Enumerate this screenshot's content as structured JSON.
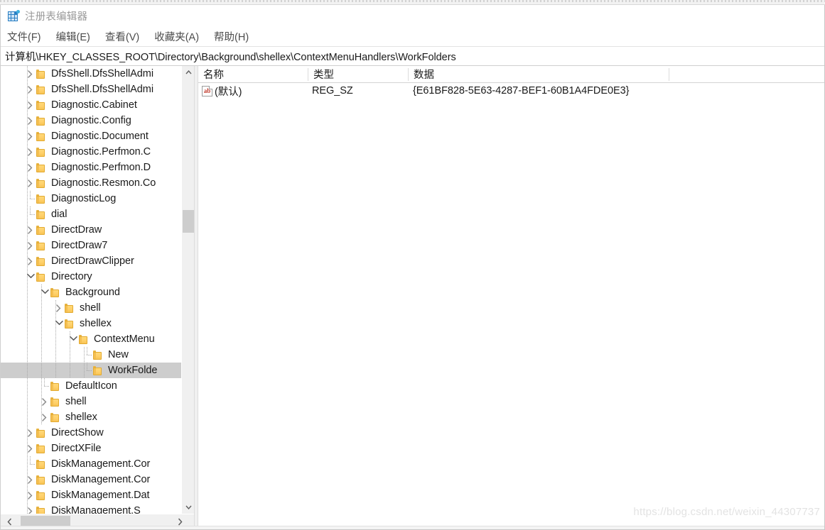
{
  "window": {
    "title": "注册表编辑器",
    "icon": "registry-editor-icon"
  },
  "menubar": {
    "items": [
      {
        "label": "文件(F)",
        "name": "menu-file"
      },
      {
        "label": "编辑(E)",
        "name": "menu-edit"
      },
      {
        "label": "查看(V)",
        "name": "menu-view"
      },
      {
        "label": "收藏夹(A)",
        "name": "menu-favorites"
      },
      {
        "label": "帮助(H)",
        "name": "menu-help"
      }
    ]
  },
  "address": {
    "path": "计算机\\HKEY_CLASSES_ROOT\\Directory\\Background\\shellex\\ContextMenuHandlers\\WorkFolders"
  },
  "tree": {
    "rows": [
      {
        "label": "DfsShell.DfsShellAdmi",
        "indent": 0,
        "expandable": true,
        "expanded": false,
        "selected": false
      },
      {
        "label": "DfsShell.DfsShellAdmi",
        "indent": 0,
        "expandable": true,
        "expanded": false,
        "selected": false
      },
      {
        "label": "Diagnostic.Cabinet",
        "indent": 0,
        "expandable": true,
        "expanded": false,
        "selected": false
      },
      {
        "label": "Diagnostic.Config",
        "indent": 0,
        "expandable": true,
        "expanded": false,
        "selected": false
      },
      {
        "label": "Diagnostic.Document",
        "indent": 0,
        "expandable": true,
        "expanded": false,
        "selected": false
      },
      {
        "label": "Diagnostic.Perfmon.C",
        "indent": 0,
        "expandable": true,
        "expanded": false,
        "selected": false
      },
      {
        "label": "Diagnostic.Perfmon.D",
        "indent": 0,
        "expandable": true,
        "expanded": false,
        "selected": false
      },
      {
        "label": "Diagnostic.Resmon.Co",
        "indent": 0,
        "expandable": true,
        "expanded": false,
        "selected": false
      },
      {
        "label": "DiagnosticLog",
        "indent": 0,
        "expandable": false,
        "expanded": false,
        "selected": false
      },
      {
        "label": "dial",
        "indent": 0,
        "expandable": false,
        "expanded": false,
        "selected": false
      },
      {
        "label": "DirectDraw",
        "indent": 0,
        "expandable": true,
        "expanded": false,
        "selected": false
      },
      {
        "label": "DirectDraw7",
        "indent": 0,
        "expandable": true,
        "expanded": false,
        "selected": false
      },
      {
        "label": "DirectDrawClipper",
        "indent": 0,
        "expandable": true,
        "expanded": false,
        "selected": false
      },
      {
        "label": "Directory",
        "indent": 0,
        "expandable": true,
        "expanded": true,
        "selected": false
      },
      {
        "label": "Background",
        "indent": 1,
        "expandable": true,
        "expanded": true,
        "selected": false
      },
      {
        "label": "shell",
        "indent": 2,
        "expandable": true,
        "expanded": false,
        "selected": false
      },
      {
        "label": "shellex",
        "indent": 2,
        "expandable": true,
        "expanded": true,
        "selected": false
      },
      {
        "label": "ContextMenu",
        "indent": 3,
        "expandable": true,
        "expanded": true,
        "selected": false
      },
      {
        "label": "New",
        "indent": 4,
        "expandable": false,
        "expanded": false,
        "selected": false
      },
      {
        "label": "WorkFolde",
        "indent": 4,
        "expandable": false,
        "expanded": false,
        "selected": true
      },
      {
        "label": "DefaultIcon",
        "indent": 1,
        "expandable": false,
        "expanded": false,
        "selected": false
      },
      {
        "label": "shell",
        "indent": 1,
        "expandable": true,
        "expanded": false,
        "selected": false
      },
      {
        "label": "shellex",
        "indent": 1,
        "expandable": true,
        "expanded": false,
        "selected": false
      },
      {
        "label": "DirectShow",
        "indent": 0,
        "expandable": true,
        "expanded": false,
        "selected": false
      },
      {
        "label": "DirectXFile",
        "indent": 0,
        "expandable": true,
        "expanded": false,
        "selected": false
      },
      {
        "label": "DiskManagement.Cor",
        "indent": 0,
        "expandable": false,
        "expanded": false,
        "selected": false
      },
      {
        "label": "DiskManagement.Cor",
        "indent": 0,
        "expandable": true,
        "expanded": false,
        "selected": false
      },
      {
        "label": "DiskManagement.Dat",
        "indent": 0,
        "expandable": true,
        "expanded": false,
        "selected": false
      },
      {
        "label": "DiskManagement.S",
        "indent": 0,
        "expandable": true,
        "expanded": false,
        "selected": false
      }
    ]
  },
  "value_list": {
    "columns": [
      {
        "label": "名称",
        "name": "column-name"
      },
      {
        "label": "类型",
        "name": "column-type"
      },
      {
        "label": "数据",
        "name": "column-data"
      }
    ],
    "rows": [
      {
        "icon": "string-value-icon",
        "name": "(默认)",
        "type": "REG_SZ",
        "data": "{E61BF828-5E63-4287-BEF1-60B1A4FDE0E3}"
      }
    ]
  },
  "watermark": {
    "text": "https://blog.csdn.net/weixin_44307737"
  },
  "colors": {
    "selection": "#cdcdcd",
    "folder": "#ffd06a",
    "title_text": "#9a9a9a",
    "string_icon": "#c0392b"
  }
}
